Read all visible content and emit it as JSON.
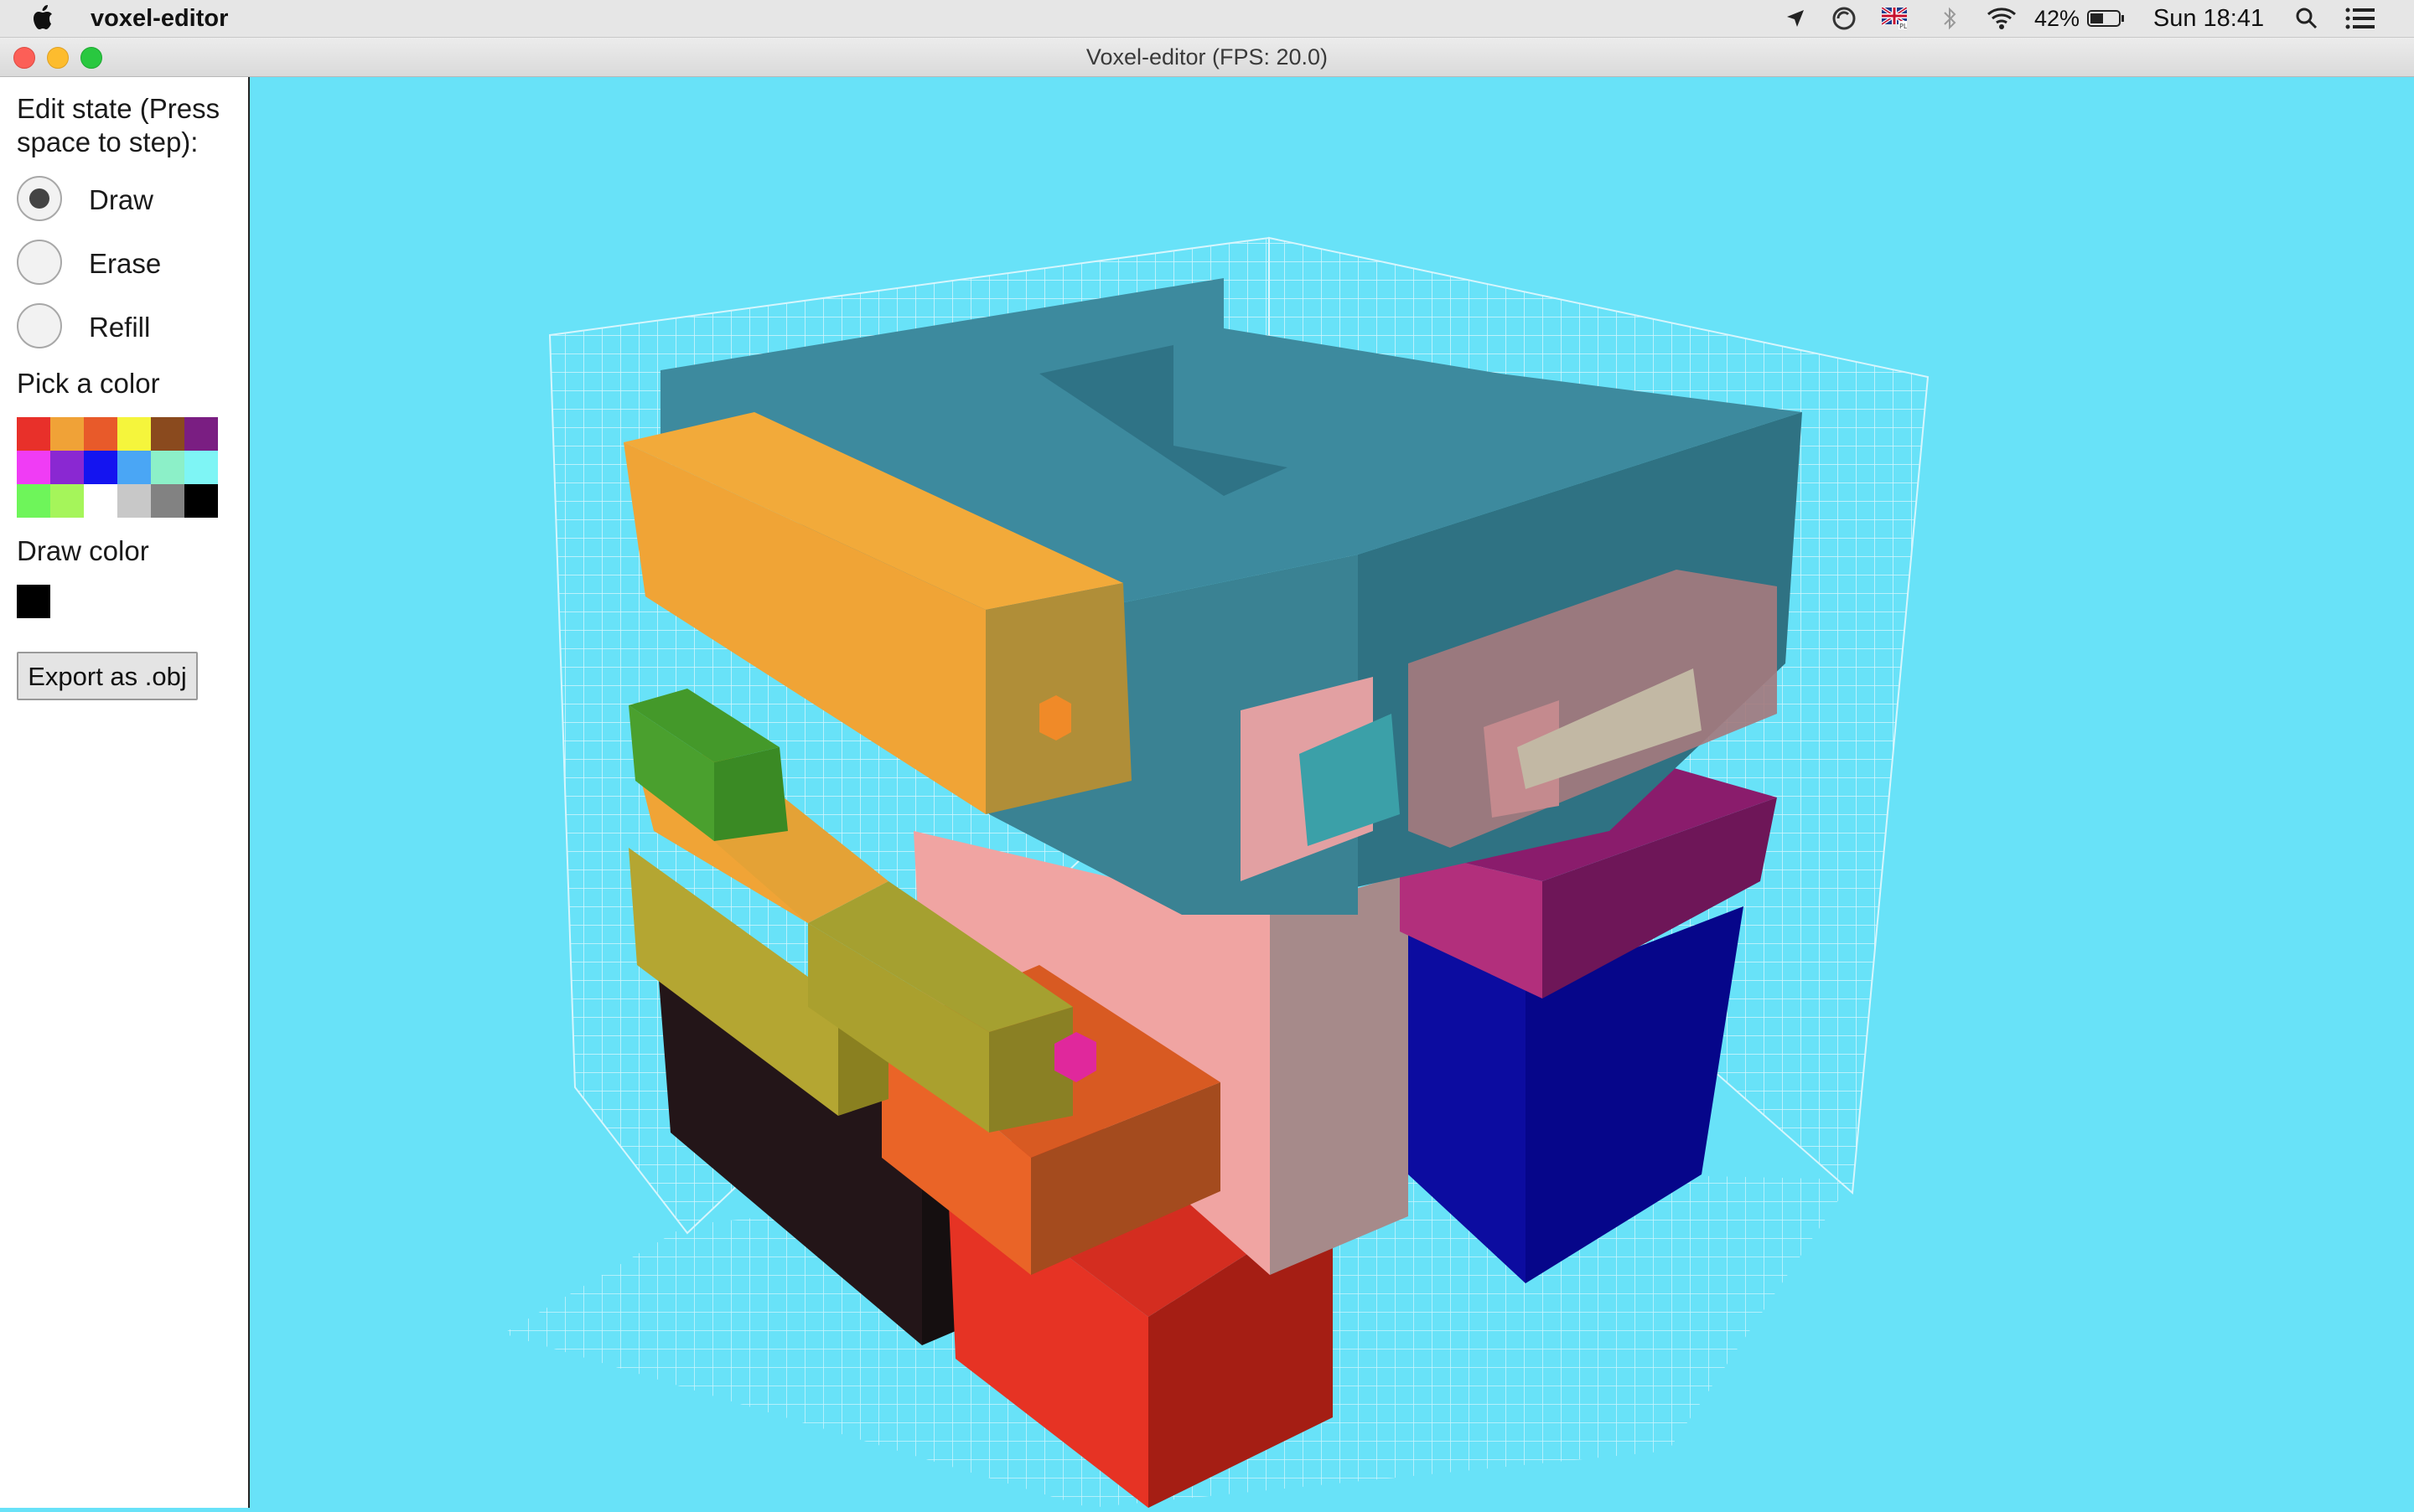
{
  "menubar": {
    "app_name": "voxel-editor",
    "battery_percent": "42%",
    "clock": "Sun 18:41",
    "icons": [
      "apple-icon",
      "location-arrow-icon",
      "sync-icon",
      "flag-uk-icon",
      "bluetooth-icon",
      "wifi-icon",
      "battery-icon",
      "search-icon",
      "list-icon"
    ]
  },
  "window": {
    "title": "Voxel-editor (FPS: 20.0)"
  },
  "panel": {
    "edit_state_label_line1": "Edit state (Press",
    "edit_state_label_line2": "space to step):",
    "modes": [
      {
        "label": "Draw",
        "selected": true
      },
      {
        "label": "Erase",
        "selected": false
      },
      {
        "label": "Refill",
        "selected": false
      }
    ],
    "pick_color_label": "Pick a color",
    "palette": [
      "#e8302a",
      "#f0a237",
      "#e85a2a",
      "#f5f53c",
      "#8a4a1e",
      "#7a1e82",
      "#f03cf5",
      "#8a28d2",
      "#1414f0",
      "#4aa6f5",
      "#8cf0c8",
      "#7ef5f5",
      "#6ef55a",
      "#a5f55a",
      "#ffffff",
      "#c8c8c8",
      "#828282",
      "#000000"
    ],
    "draw_color_label": "Draw color",
    "draw_color": "#000000",
    "export_label": "Export as .obj"
  },
  "scene": {
    "background": "#68e2f8"
  }
}
